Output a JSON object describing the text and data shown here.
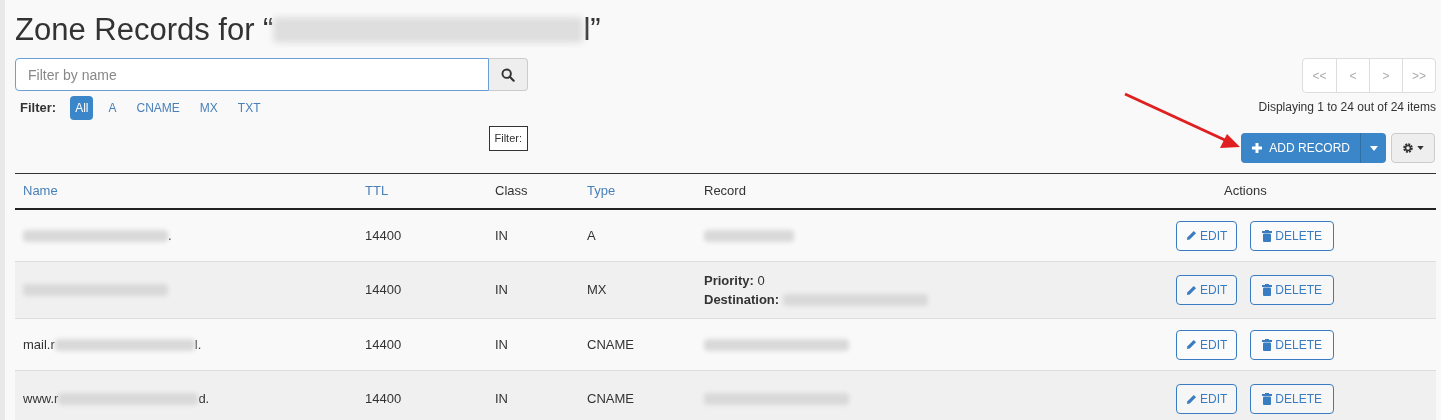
{
  "title": {
    "text": "Zone Records for “",
    "suffix": "l”"
  },
  "search": {
    "placeholder": "Filter by name"
  },
  "filter": {
    "label": "Filter:",
    "options": [
      {
        "label": "All",
        "selected": true
      },
      {
        "label": "A",
        "selected": false
      },
      {
        "label": "CNAME",
        "selected": false
      },
      {
        "label": "MX",
        "selected": false
      },
      {
        "label": "TXT",
        "selected": false
      }
    ]
  },
  "tooltip": "Filter:",
  "pagination": {
    "buttons": [
      "<<",
      "<",
      ">",
      ">>"
    ],
    "summary": "Displaying 1 to 24 out of 24 items"
  },
  "add_button": "ADD RECORD",
  "table": {
    "columns": [
      {
        "label": "Name",
        "sortable": true
      },
      {
        "label": "TTL",
        "sortable": true
      },
      {
        "label": "Class",
        "sortable": false
      },
      {
        "label": "Type",
        "sortable": true
      },
      {
        "label": "Record",
        "sortable": false
      },
      {
        "label": "Actions",
        "sortable": false
      }
    ],
    "rows": [
      {
        "name": {
          "suffix": "."
        },
        "ttl": "14400",
        "class": "IN",
        "type": "A",
        "record": {
          "kind": "plain"
        },
        "edit": "EDIT",
        "delete": "DELETE"
      },
      {
        "name": {},
        "ttl": "14400",
        "class": "IN",
        "type": "MX",
        "record": {
          "kind": "mx",
          "priority_label": "Priority:",
          "priority": "0",
          "destination_label": "Destination:"
        },
        "edit": "EDIT",
        "delete": "DELETE"
      },
      {
        "name": {
          "prefix": "mail.r",
          "suffix": "l."
        },
        "ttl": "14400",
        "class": "IN",
        "type": "CNAME",
        "record": {
          "kind": "plain"
        },
        "edit": "EDIT",
        "delete": "DELETE"
      },
      {
        "name": {
          "prefix": "www.r",
          "suffix": "d."
        },
        "ttl": "14400",
        "class": "IN",
        "type": "CNAME",
        "record": {
          "kind": "plain"
        },
        "edit": "EDIT",
        "delete": "DELETE"
      }
    ]
  }
}
